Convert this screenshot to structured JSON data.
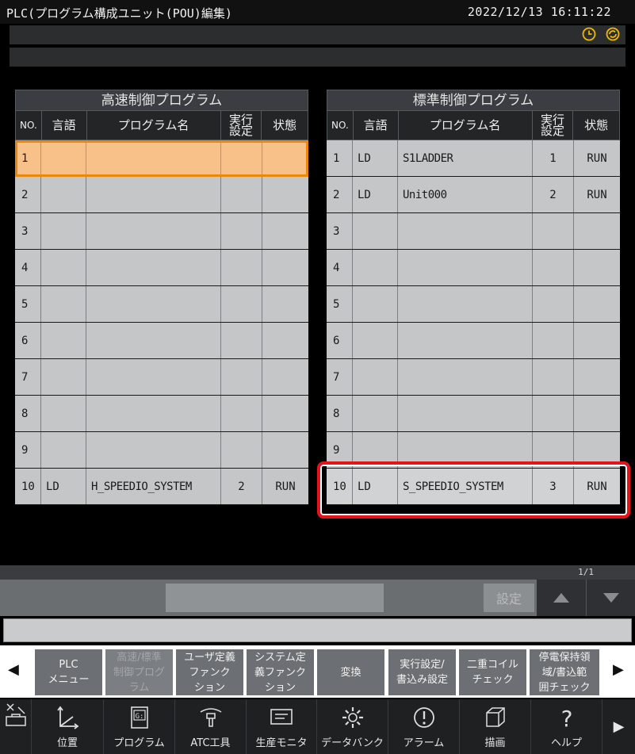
{
  "window": {
    "title": "PLC(プログラム構成ユニット(POU)編集)",
    "datetime": "2022/12/13  16:11:22"
  },
  "status_icons": [
    "clock-icon",
    "cycle-icon"
  ],
  "tables": {
    "high_speed": {
      "title": "高速制御プログラム",
      "columns": [
        "NO.",
        "言語",
        "プログラム名",
        "実行\n設定",
        "状態"
      ],
      "rows": [
        {
          "no": "1",
          "lang": "",
          "name": "",
          "exec": "",
          "status": ""
        },
        {
          "no": "2",
          "lang": "",
          "name": "",
          "exec": "",
          "status": ""
        },
        {
          "no": "3",
          "lang": "",
          "name": "",
          "exec": "",
          "status": ""
        },
        {
          "no": "4",
          "lang": "",
          "name": "",
          "exec": "",
          "status": ""
        },
        {
          "no": "5",
          "lang": "",
          "name": "",
          "exec": "",
          "status": ""
        },
        {
          "no": "6",
          "lang": "",
          "name": "",
          "exec": "",
          "status": ""
        },
        {
          "no": "7",
          "lang": "",
          "name": "",
          "exec": "",
          "status": ""
        },
        {
          "no": "8",
          "lang": "",
          "name": "",
          "exec": "",
          "status": ""
        },
        {
          "no": "9",
          "lang": "",
          "name": "",
          "exec": "",
          "status": ""
        },
        {
          "no": "10",
          "lang": "LD",
          "name": "H_SPEEDIO_SYSTEM",
          "exec": "2",
          "status": "RUN"
        }
      ]
    },
    "standard": {
      "title": "標準制御プログラム",
      "columns": [
        "NO.",
        "言語",
        "プログラム名",
        "実行\n設定",
        "状態"
      ],
      "rows": [
        {
          "no": "1",
          "lang": "LD",
          "name": "S1LADDER",
          "exec": "1",
          "status": "RUN"
        },
        {
          "no": "2",
          "lang": "LD",
          "name": "Unit000",
          "exec": "2",
          "status": "RUN"
        },
        {
          "no": "3",
          "lang": "",
          "name": "",
          "exec": "",
          "status": ""
        },
        {
          "no": "4",
          "lang": "",
          "name": "",
          "exec": "",
          "status": ""
        },
        {
          "no": "5",
          "lang": "",
          "name": "",
          "exec": "",
          "status": ""
        },
        {
          "no": "6",
          "lang": "",
          "name": "",
          "exec": "",
          "status": ""
        },
        {
          "no": "7",
          "lang": "",
          "name": "",
          "exec": "",
          "status": ""
        },
        {
          "no": "8",
          "lang": "",
          "name": "",
          "exec": "",
          "status": ""
        },
        {
          "no": "9",
          "lang": "",
          "name": "",
          "exec": "",
          "status": ""
        },
        {
          "no": "10",
          "lang": "LD",
          "name": "S_SPEEDIO_SYSTEM",
          "exec": "3",
          "status": "RUN"
        }
      ]
    }
  },
  "entry": {
    "page_indicator": "1/1",
    "set_label": "設定"
  },
  "function_keys": [
    {
      "label": "PLC\nメニュー",
      "enabled": true
    },
    {
      "label": "高速/標準\n制御プログ\nラム",
      "enabled": false
    },
    {
      "label": "ユーザ定義\nファンク\nション",
      "enabled": true
    },
    {
      "label": "システム定\n義ファンク\nション",
      "enabled": true
    },
    {
      "label": "変換",
      "enabled": true
    },
    {
      "label": "実行設定/\n書込み設定",
      "enabled": true
    },
    {
      "label": "二重コイル\nチェック",
      "enabled": true
    },
    {
      "label": "停電保持領\n域/書込範\n囲チェック",
      "enabled": true
    }
  ],
  "menu": [
    {
      "label": "",
      "icon": "maintenance-icon"
    },
    {
      "label": "位置",
      "icon": "axes-icon"
    },
    {
      "label": "プログラム",
      "icon": "program-icon"
    },
    {
      "label": "ATC工具",
      "icon": "tool-icon"
    },
    {
      "label": "生産モニタ",
      "icon": "monitor-icon"
    },
    {
      "label": "データバンク",
      "icon": "gear-icon"
    },
    {
      "label": "アラーム",
      "icon": "alarm-icon"
    },
    {
      "label": "描画",
      "icon": "cube-icon"
    },
    {
      "label": "ヘルプ",
      "icon": "help-icon"
    }
  ]
}
